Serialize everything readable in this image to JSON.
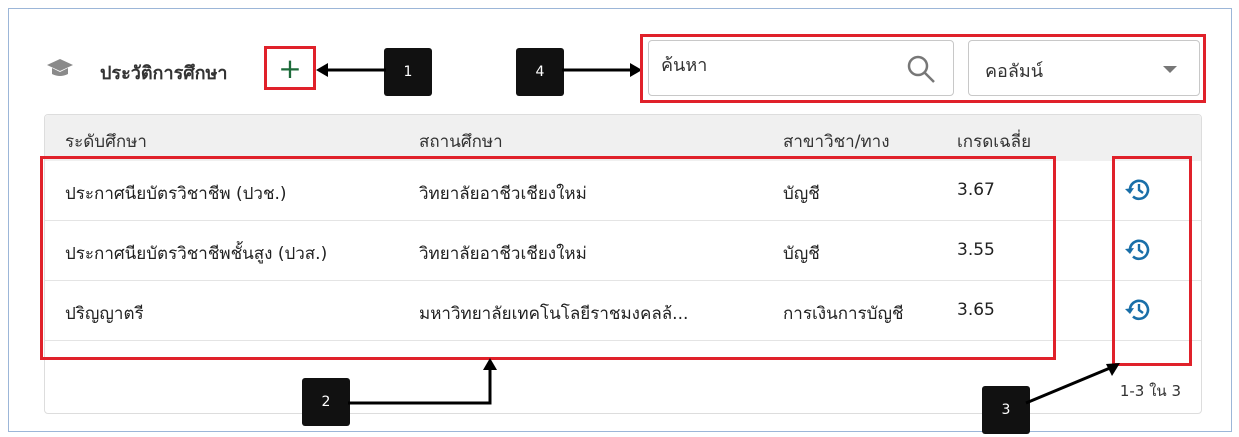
{
  "section": {
    "title": "ประวัติการศึกษา",
    "add_label": "+"
  },
  "search": {
    "placeholder": "ค้นหา"
  },
  "column_select": {
    "label": "คอลัมน์"
  },
  "table": {
    "headers": [
      "ระดับศึกษา",
      "สถานศึกษา",
      "สาขาวิชา/ทาง",
      "เกรดเฉลี่ย"
    ],
    "rows": [
      {
        "level": "ประกาศนียบัตรวิชาชีพ (ปวช.)",
        "school": "วิทยาลัยอาชีวเชียงใหม่",
        "major": "บัญชี",
        "gpa": "3.67"
      },
      {
        "level": "ประกาศนียบัตรวิชาชีพชั้นสูง (ปวส.)",
        "school": "วิทยาลัยอาชีวเชียงใหม่",
        "major": "บัญชี",
        "gpa": "3.55"
      },
      {
        "level": "ปริญญาตรี",
        "school": "มหาวิทยาลัยเทคโนโลยีราชมงคลล้...",
        "major": "การเงินการบัญชี",
        "gpa": "3.65"
      }
    ],
    "pagination": "1-3 ใน 3"
  },
  "callouts": {
    "c1": "1",
    "c2": "2",
    "c3": "3",
    "c4": "4"
  },
  "colors": {
    "highlight": "#e0212a",
    "accent": "#1d6b3a",
    "history_icon": "#1a6fa8"
  },
  "icons": [
    "graduation-cap-icon",
    "plus-icon",
    "search-icon",
    "chevron-down-icon",
    "history-icon"
  ]
}
